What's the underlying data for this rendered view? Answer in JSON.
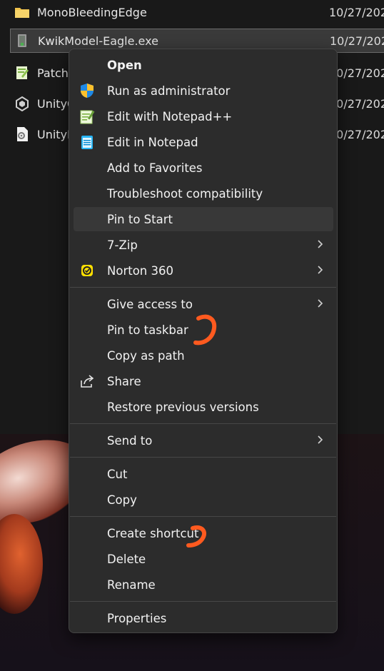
{
  "explorer": {
    "files": [
      {
        "name": "MonoBleedingEdge",
        "date": "10/27/202",
        "icon": "folder-icon"
      },
      {
        "name": "KwikModel-Eagle.exe",
        "date": "10/27/202",
        "icon": "exe-icon"
      },
      {
        "name": "PatchM",
        "date": "10/27/202",
        "icon": "notepadpp-file-icon"
      },
      {
        "name": "UnityC",
        "date": "10/27/202",
        "icon": "unity-icon"
      },
      {
        "name": "UnityP",
        "date": "10/27/202",
        "icon": "settings-file-icon"
      }
    ]
  },
  "context_menu": {
    "items": [
      {
        "label": "Open",
        "icon": "",
        "bold": true
      },
      {
        "label": "Run as administrator",
        "icon": "uac-shield-icon"
      },
      {
        "label": "Edit with Notepad++",
        "icon": "notepadpp-icon"
      },
      {
        "label": "Edit in Notepad",
        "icon": "notepad-icon"
      },
      {
        "label": "Add to Favorites",
        "icon": ""
      },
      {
        "label": "Troubleshoot compatibility",
        "icon": ""
      },
      {
        "label": "Pin to Start",
        "icon": "",
        "hover": true
      },
      {
        "label": "7-Zip",
        "icon": "",
        "submenu": true
      },
      {
        "label": "Norton 360",
        "icon": "norton-icon",
        "submenu": true
      },
      {
        "label": "Give access to",
        "icon": "",
        "submenu": true
      },
      {
        "label": "Pin to taskbar",
        "icon": ""
      },
      {
        "label": "Copy as path",
        "icon": ""
      },
      {
        "label": "Share",
        "icon": "share-icon"
      },
      {
        "label": "Restore previous versions",
        "icon": ""
      },
      {
        "label": "Send to",
        "icon": "",
        "submenu": true
      },
      {
        "label": "Cut",
        "icon": ""
      },
      {
        "label": "Copy",
        "icon": ""
      },
      {
        "label": "Create shortcut",
        "icon": ""
      },
      {
        "label": "Delete",
        "icon": ""
      },
      {
        "label": "Rename",
        "icon": ""
      },
      {
        "label": "Properties",
        "icon": ""
      }
    ]
  },
  "colors": {
    "menu_bg": "#2c2c2c",
    "hover_bg": "#383838",
    "annotation": "#ff5a1f"
  }
}
